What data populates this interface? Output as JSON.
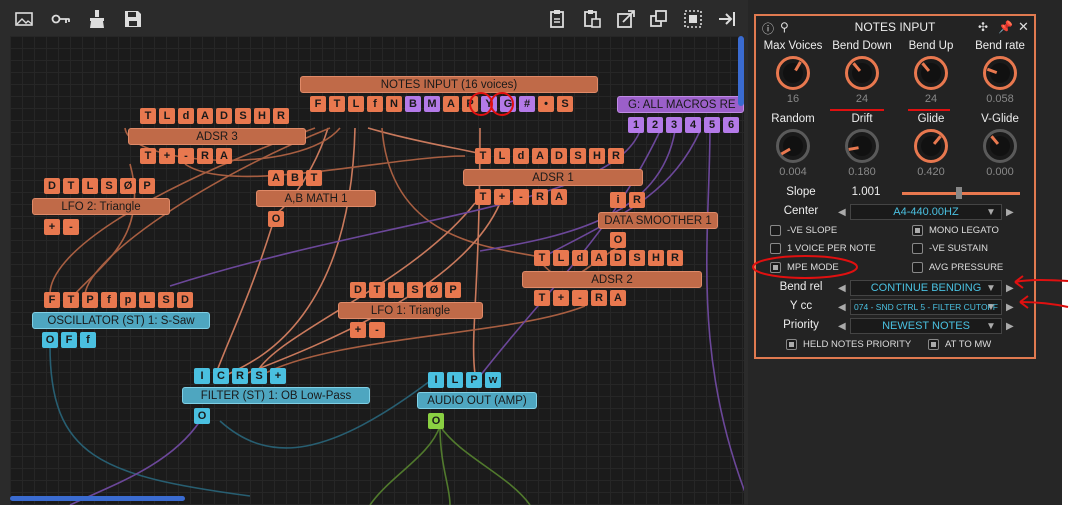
{
  "toolbar": {
    "icons_left": [
      "image-icon",
      "key-icon",
      "broom-icon",
      "save-icon"
    ],
    "icons_right": [
      "clipboard-icon",
      "paste-icon",
      "cut-icon",
      "copy-icon",
      "select-all-icon",
      "export-icon"
    ]
  },
  "graph": {
    "notes_input": {
      "title": "NOTES INPUT (16 voices)",
      "ports": [
        "F",
        "T",
        "L",
        "f",
        "N",
        "B",
        "M",
        "A",
        "P",
        "Y",
        "G",
        "#",
        "•",
        "S"
      ]
    },
    "adsr3": {
      "title": "ADSR 3",
      "inputs": [
        "T",
        "L",
        "d",
        "A",
        "D",
        "S",
        "H",
        "R"
      ],
      "outputs": [
        "T",
        "+",
        "-",
        "R",
        "A"
      ]
    },
    "lfo2": {
      "title": "LFO 2: Triangle",
      "inputs": [
        "D",
        "T",
        "L",
        "S",
        "Ø",
        "P"
      ],
      "outputs": [
        "+",
        "-"
      ]
    },
    "math": {
      "title": "A,B MATH 1",
      "inputs": [
        "A",
        "B",
        "T"
      ],
      "outputs": [
        "O"
      ]
    },
    "adsr1": {
      "title": "ADSR 1",
      "inputs": [
        "T",
        "L",
        "d",
        "A",
        "D",
        "S",
        "H",
        "R"
      ],
      "outputs": [
        "T",
        "+",
        "-",
        "R",
        "A"
      ]
    },
    "macros": {
      "title": "G: ALL MACROS RE",
      "outputs": [
        "1",
        "2",
        "3",
        "4",
        "5",
        "6"
      ]
    },
    "smoother": {
      "title": "DATA SMOOTHER 1",
      "inputs": [
        "i",
        "R"
      ],
      "outputs": [
        "O"
      ]
    },
    "adsr2": {
      "title": "ADSR 2",
      "inputs": [
        "T",
        "L",
        "d",
        "A",
        "D",
        "S",
        "H",
        "R"
      ],
      "outputs": [
        "T",
        "+",
        "-",
        "R",
        "A"
      ]
    },
    "osc": {
      "title": "OSCILLATOR (ST) 1: S-Saw",
      "inputs": [
        "F",
        "T",
        "P",
        "f",
        "p",
        "L",
        "S",
        "D"
      ],
      "outputs": [
        "O",
        "F",
        "f"
      ]
    },
    "lfo1": {
      "title": "LFO 1: Triangle",
      "inputs": [
        "D",
        "T",
        "L",
        "S",
        "Ø",
        "P"
      ],
      "outputs": [
        "+",
        "-"
      ]
    },
    "filter": {
      "title": "FILTER (ST) 1: OB Low-Pass",
      "inputs": [
        "I",
        "C",
        "R",
        "S",
        "+"
      ],
      "outputs": [
        "O"
      ]
    },
    "audio": {
      "title": "AUDIO OUT (AMP)",
      "inputs": [
        "I",
        "L",
        "P",
        "w"
      ],
      "outputs": [
        "O"
      ]
    }
  },
  "panel": {
    "title": "NOTES INPUT",
    "knobs_row1": [
      {
        "label": "Max Voices",
        "value": "16"
      },
      {
        "label": "Bend Down",
        "value": "24"
      },
      {
        "label": "Bend Up",
        "value": "24"
      },
      {
        "label": "Bend rate",
        "value": "0.058"
      }
    ],
    "knobs_row2": [
      {
        "label": "Random",
        "value": "0.004"
      },
      {
        "label": "Drift",
        "value": "0.180"
      },
      {
        "label": "Glide",
        "value": "0.420"
      },
      {
        "label": "V-Glide",
        "value": "0.000"
      }
    ],
    "slope": {
      "label": "Slope",
      "value": "1.001"
    },
    "center": {
      "label": "Center",
      "value": "A4-440.00HZ"
    },
    "checkboxes": [
      {
        "label": "-VE SLOPE",
        "checked": false
      },
      {
        "label": "MONO LEGATO",
        "checked": true
      },
      {
        "label": "1 VOICE PER NOTE",
        "checked": false
      },
      {
        "label": "-VE SUSTAIN",
        "checked": false
      },
      {
        "label": "MPE MODE",
        "checked": true
      },
      {
        "label": "AVG PRESSURE",
        "checked": false
      }
    ],
    "bend_rel": {
      "label": "Bend rel",
      "value": "CONTINUE BENDING"
    },
    "ycc": {
      "label": "Y cc",
      "value": "074 - SND CTRL 5 - FILTER CUTOFF"
    },
    "priority": {
      "label": "Priority",
      "value": "NEWEST NOTES"
    },
    "bottom": [
      {
        "label": "HELD NOTES PRIORITY",
        "checked": true
      },
      {
        "label": "AT TO MW",
        "checked": true
      }
    ]
  },
  "colors": {
    "accent": "#e8784f",
    "teal": "#4ac0e0",
    "purple": "#b47ae8",
    "annotation": "#e01010"
  }
}
